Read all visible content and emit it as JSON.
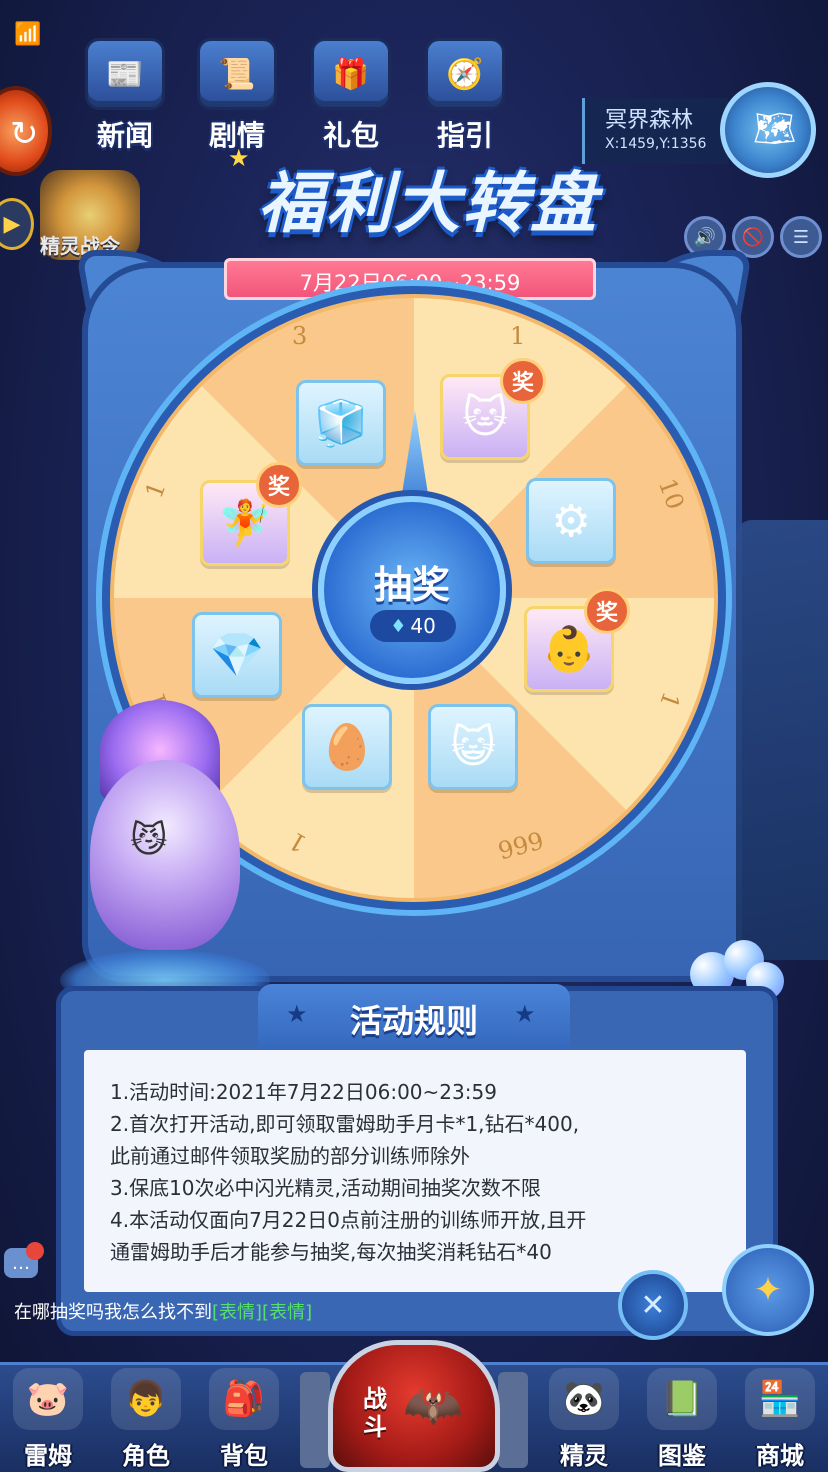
{
  "top_menu": [
    {
      "label": "新闻",
      "icon": "newspaper-icon",
      "glyph": "📰"
    },
    {
      "label": "剧情",
      "icon": "story-icon",
      "glyph": "📜"
    },
    {
      "label": "礼包",
      "icon": "gift-icon",
      "glyph": "🎁"
    },
    {
      "label": "指引",
      "icon": "guide-icon",
      "glyph": "🧭"
    }
  ],
  "jingling_badge": {
    "label": "精灵战令"
  },
  "location": {
    "name": "冥界森林",
    "coords": "X:1459,Y:1356"
  },
  "event": {
    "title": "福利大转盘",
    "time_banner": "7月22日06:00~23:59"
  },
  "wheel": {
    "numbers": [
      "3",
      "1",
      "10",
      "1",
      "999",
      "1",
      "1",
      "1"
    ],
    "prize_badge": "奖",
    "prizes": [
      {
        "name": "sugar-cube-icon",
        "glyph": "🧊"
      },
      {
        "name": "purple-cat-pet-icon",
        "glyph": "🐱",
        "special": true
      },
      {
        "name": "gear-badge-icon",
        "glyph": "⚙"
      },
      {
        "name": "blonde-pet-icon",
        "glyph": "👶",
        "special": true
      },
      {
        "name": "cat-face-icon",
        "glyph": "😺"
      },
      {
        "name": "pet-egg-icon",
        "glyph": "🥚"
      },
      {
        "name": "diamond-icon",
        "glyph": "💎"
      },
      {
        "name": "pink-fairy-pet-icon",
        "glyph": "🧚",
        "special": true
      }
    ],
    "draw_button": {
      "label": "抽奖",
      "cost": "40"
    }
  },
  "rules": {
    "title": "活动规则",
    "lines": [
      "1.活动时间:2021年7月22日06:00~23:59",
      "2.首次打开活动,即可领取雷姆助手月卡*1,钻石*400,",
      "此前通过邮件领取奖励的部分训练师除外",
      "3.保底10次必中闪光精灵,活动期间抽奖次数不限",
      "4.本活动仅面向7月22日0点前注册的训练师开放,且开",
      "通雷姆助手后才能参与抽奖,每次抽奖消耗钻石*40"
    ]
  },
  "chat": {
    "message": "在哪抽奖吗我怎么找不到",
    "emoji_tag": "[表情][表情]"
  },
  "bottom_nav": {
    "left": [
      {
        "label": "雷姆",
        "icon": "leimu-icon",
        "glyph": "🐷"
      },
      {
        "label": "角色",
        "icon": "character-icon",
        "glyph": "👦"
      },
      {
        "label": "背包",
        "icon": "backpack-icon",
        "glyph": "🎒"
      }
    ],
    "battle": {
      "label": "战斗",
      "glyph": "🦇"
    },
    "right": [
      {
        "label": "精灵",
        "icon": "pet-icon",
        "glyph": "🐼"
      },
      {
        "label": "图鉴",
        "icon": "handbook-icon",
        "glyph": "📗"
      },
      {
        "label": "商城",
        "icon": "shop-icon",
        "glyph": "🏪"
      }
    ]
  },
  "colors": {
    "title_outline": "#1c5bc8",
    "date_banner": "#f2557a",
    "wheel_light": "#fde3ae",
    "wheel_dark": "#f9c88a",
    "badge": "#e8643a",
    "chat_emoji": "#55e06a"
  }
}
